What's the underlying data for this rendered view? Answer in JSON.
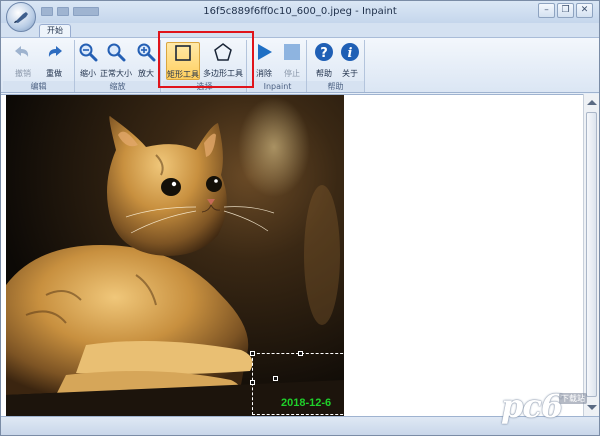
{
  "window": {
    "title": "16f5c889f6ff0c10_600_0.jpeg - Inpaint",
    "controls": {
      "minimize": "–",
      "restore": "❒",
      "close": "✕"
    }
  },
  "tabs": [
    {
      "label": "开始"
    }
  ],
  "ribbon": {
    "groups": [
      {
        "label": "编辑",
        "buttons": [
          {
            "label": "撤销",
            "icon": "undo-icon",
            "enabled": false
          },
          {
            "label": "重做",
            "icon": "redo-icon",
            "enabled": true
          }
        ]
      },
      {
        "label": "缩放",
        "buttons": [
          {
            "label": "缩小",
            "icon": "zoom-out-icon"
          },
          {
            "label": "正常大小",
            "icon": "zoom-actual-icon"
          },
          {
            "label": "放大",
            "icon": "zoom-in-icon"
          }
        ]
      },
      {
        "label": "选择",
        "buttons": [
          {
            "label": "矩形工具",
            "icon": "rectangle-icon",
            "active": true
          },
          {
            "label": "多边形工具",
            "icon": "polygon-icon"
          }
        ]
      },
      {
        "label": "Inpaint",
        "buttons": [
          {
            "label": "消除",
            "icon": "play-icon"
          },
          {
            "label": "停止",
            "icon": "stop-icon",
            "enabled": false
          }
        ]
      },
      {
        "label": "帮助",
        "buttons": [
          {
            "label": "帮助",
            "icon": "help-icon"
          },
          {
            "label": "关于",
            "icon": "info-icon"
          }
        ]
      }
    ]
  },
  "canvas": {
    "date_stamp": "2018-12-6"
  },
  "watermark": {
    "main": "pc6",
    "sub": "下载站"
  },
  "colors": {
    "accent": "#1f6fc4",
    "highlight": "#e0141b",
    "date_stamp": "#1fd02a"
  }
}
